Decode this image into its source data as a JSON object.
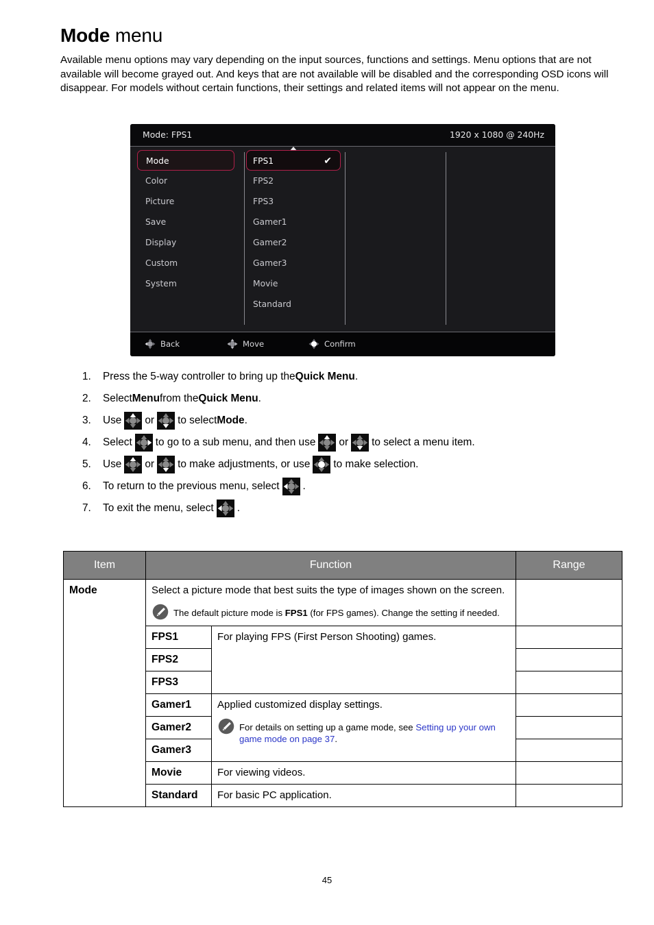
{
  "heading": {
    "bold": "Mode",
    "light": " menu"
  },
  "intro": "Available menu options may vary depending on the input sources, functions and settings. Menu options that are not available will become grayed out. And keys that are not available will be disabled and the corresponding OSD icons will disappear. For models without certain functions, their settings and related items will not appear on the menu.",
  "osd": {
    "mode_label": "Mode: FPS1",
    "resolution_label": "1920 x 1080 @ 240Hz",
    "menu_items": [
      {
        "label": "Mode",
        "selected": true
      },
      {
        "label": "Color",
        "selected": false
      },
      {
        "label": "Picture",
        "selected": false
      },
      {
        "label": "Save",
        "selected": false
      },
      {
        "label": "Display",
        "selected": false
      },
      {
        "label": "Custom",
        "selected": false
      },
      {
        "label": "System",
        "selected": false
      }
    ],
    "sub_items": [
      {
        "label": "FPS1",
        "selected": true,
        "checked": true
      },
      {
        "label": "FPS2",
        "selected": false,
        "checked": false
      },
      {
        "label": "FPS3",
        "selected": false,
        "checked": false
      },
      {
        "label": "Gamer1",
        "selected": false,
        "checked": false
      },
      {
        "label": "Gamer2",
        "selected": false,
        "checked": false
      },
      {
        "label": "Gamer3",
        "selected": false,
        "checked": false
      },
      {
        "label": "Movie",
        "selected": false,
        "checked": false
      },
      {
        "label": "Standard",
        "selected": false,
        "checked": false
      }
    ],
    "footer": {
      "back": "Back",
      "move": "Move",
      "confirm": "Confirm"
    },
    "colors": {
      "highlight_border": "#b0204a",
      "panel_bg": "#1a1a1d",
      "header_bg": "#0a0a0c"
    }
  },
  "steps": [
    {
      "num": "1.",
      "parts": [
        {
          "t": "text",
          "v": "Press the 5-way controller to bring up the "
        },
        {
          "t": "bold",
          "v": "Quick Menu"
        },
        {
          "t": "text",
          "v": "."
        }
      ]
    },
    {
      "num": "2.",
      "parts": [
        {
          "t": "text",
          "v": "Select "
        },
        {
          "t": "bold",
          "v": "Menu"
        },
        {
          "t": "text",
          "v": " from the "
        },
        {
          "t": "bold",
          "v": "Quick Menu"
        },
        {
          "t": "text",
          "v": "."
        }
      ]
    },
    {
      "num": "3.",
      "parts": [
        {
          "t": "text",
          "v": "Use "
        },
        {
          "t": "icon",
          "v": "controller-up-icon"
        },
        {
          "t": "text",
          "v": " or "
        },
        {
          "t": "icon",
          "v": "controller-down-icon"
        },
        {
          "t": "text",
          "v": " to select "
        },
        {
          "t": "bold",
          "v": "Mode"
        },
        {
          "t": "text",
          "v": "."
        }
      ]
    },
    {
      "num": "4.",
      "parts": [
        {
          "t": "text",
          "v": "Select "
        },
        {
          "t": "icon",
          "v": "controller-right-icon"
        },
        {
          "t": "text",
          "v": " to go to a sub menu, and then use "
        },
        {
          "t": "icon",
          "v": "controller-up-icon"
        },
        {
          "t": "text",
          "v": " or "
        },
        {
          "t": "icon",
          "v": "controller-down-icon"
        },
        {
          "t": "text",
          "v": " to select a menu item."
        }
      ]
    },
    {
      "num": "5.",
      "parts": [
        {
          "t": "text",
          "v": "Use "
        },
        {
          "t": "icon",
          "v": "controller-up-icon"
        },
        {
          "t": "text",
          "v": " or "
        },
        {
          "t": "icon",
          "v": "controller-down-icon"
        },
        {
          "t": "text",
          "v": " to make adjustments, or use "
        },
        {
          "t": "icon",
          "v": "controller-center-icon"
        },
        {
          "t": "text",
          "v": " to make selection."
        }
      ]
    },
    {
      "num": "6.",
      "parts": [
        {
          "t": "text",
          "v": "To return to the previous menu, select "
        },
        {
          "t": "icon",
          "v": "controller-left-icon"
        },
        {
          "t": "text",
          "v": "."
        }
      ]
    },
    {
      "num": "7.",
      "parts": [
        {
          "t": "text",
          "v": "To exit the menu, select "
        },
        {
          "t": "icon",
          "v": "controller-left-icon"
        },
        {
          "t": "text",
          "v": "."
        }
      ]
    }
  ],
  "table": {
    "headers": [
      "Item",
      "Function",
      "Range"
    ],
    "item": "Mode",
    "mode_function": "Select a picture mode that best suits the type of images shown on the screen.",
    "mode_note": {
      "before": "The default picture mode is ",
      "bold": "FPS1",
      "after": " (for FPS games). Change the setting if needed."
    },
    "rows": [
      {
        "sub": "FPS1",
        "function": "For playing FPS (First Person Shooting) games.",
        "range": ""
      },
      {
        "sub": "FPS2",
        "function": "",
        "range": ""
      },
      {
        "sub": "FPS3",
        "function": "",
        "range": ""
      },
      {
        "sub": "Gamer1",
        "function": "Applied customized display settings.",
        "range": ""
      },
      {
        "sub": "Gamer2",
        "function": "",
        "range": ""
      },
      {
        "sub": "Gamer3",
        "function": "",
        "range": ""
      },
      {
        "sub": "Movie",
        "function": "For viewing videos.",
        "range": ""
      },
      {
        "sub": "Standard",
        "function": "For basic PC application.",
        "range": ""
      }
    ],
    "gamer_note": {
      "before": "For details on setting up a game mode, see ",
      "link": "Setting up your own game mode on page 37",
      "after": "."
    }
  },
  "page_number": "45"
}
